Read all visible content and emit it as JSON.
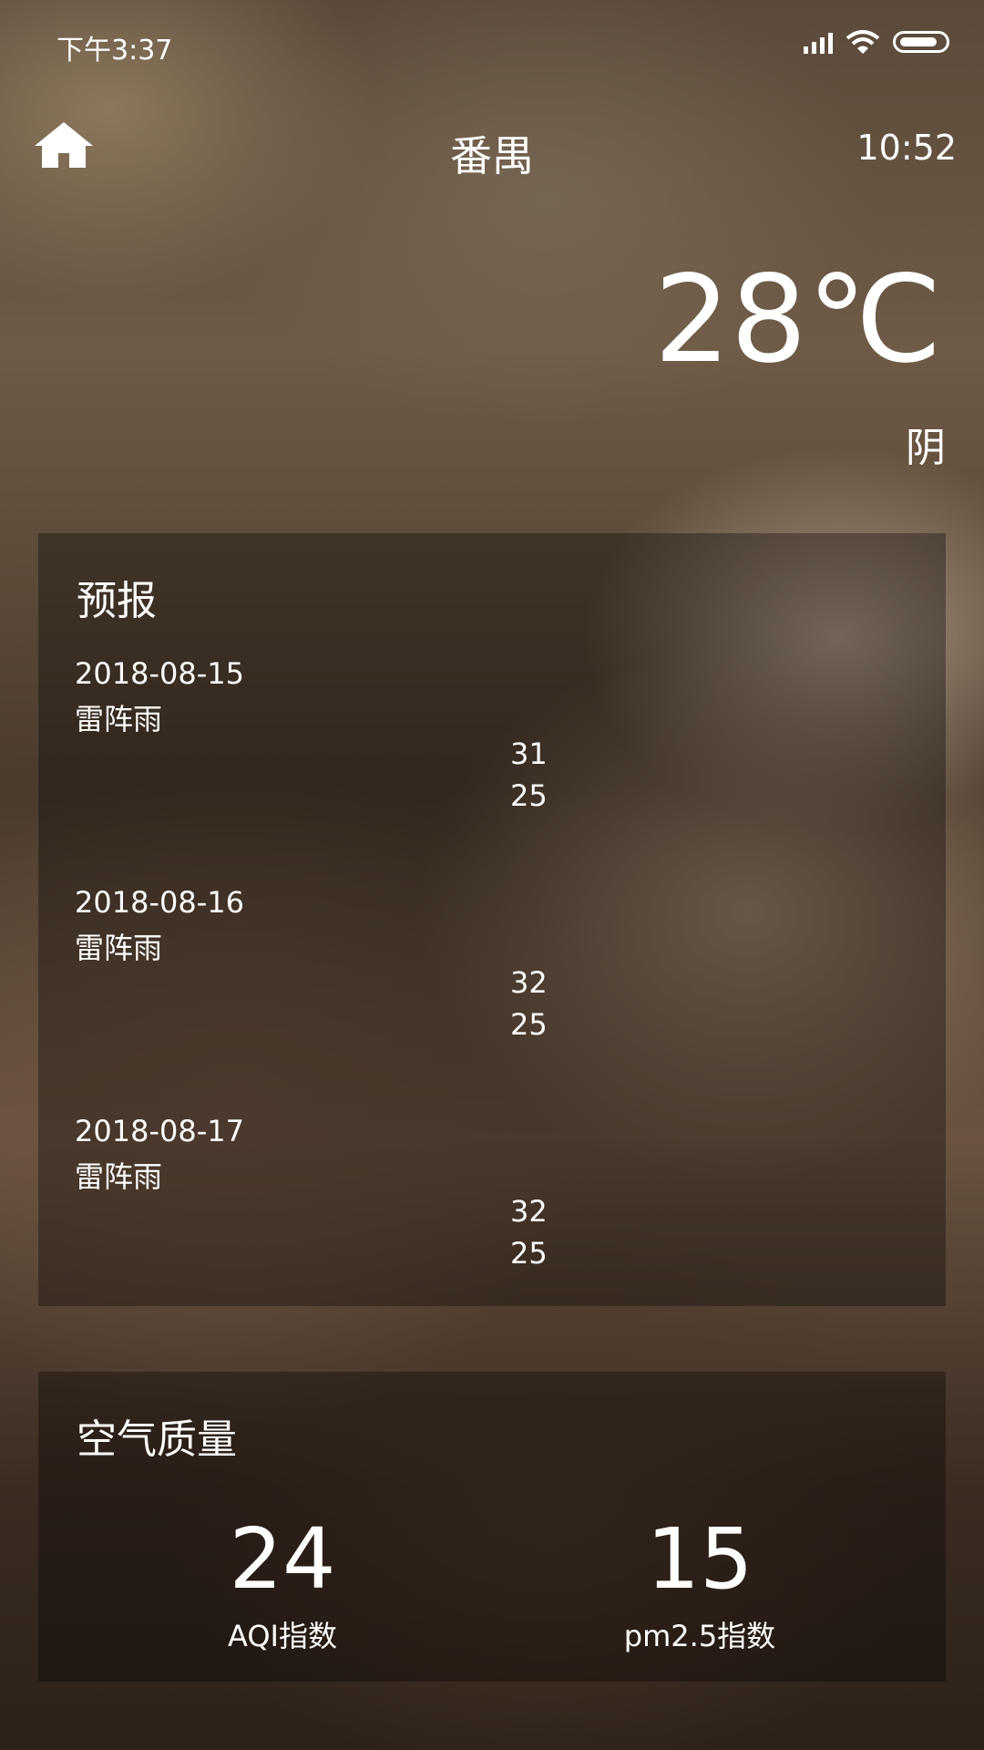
{
  "status_bar": {
    "time": "下午3:37"
  },
  "header": {
    "city": "番禺",
    "update_time": "10:52"
  },
  "now": {
    "temperature": "28℃",
    "weather": "阴"
  },
  "forecast": {
    "title": "预报",
    "items": [
      {
        "date": "2018-08-15",
        "info": "雷阵雨",
        "max": "31",
        "min": "25"
      },
      {
        "date": "2018-08-16",
        "info": "雷阵雨",
        "max": "32",
        "min": "25"
      },
      {
        "date": "2018-08-17",
        "info": "雷阵雨",
        "max": "32",
        "min": "25"
      }
    ]
  },
  "aqi": {
    "title": "空气质量",
    "aqi_value": "24",
    "aqi_label": "AQI指数",
    "pm25_value": "15",
    "pm25_label": "pm2.5指数"
  }
}
